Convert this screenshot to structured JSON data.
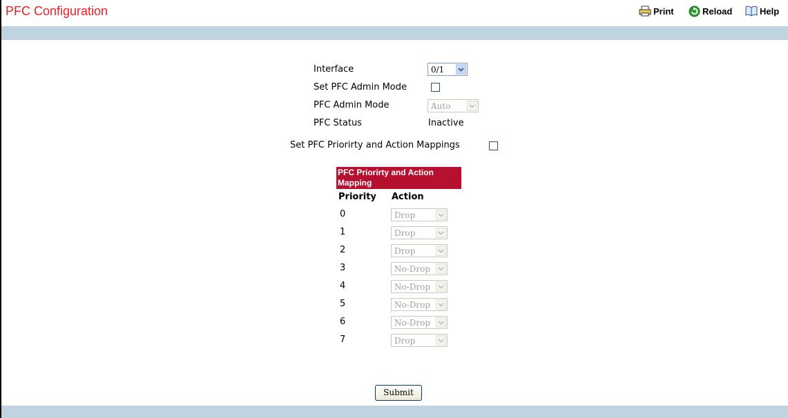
{
  "header": {
    "title": "PFC Configuration",
    "print_label": "Print",
    "reload_label": "Reload",
    "help_label": "Help"
  },
  "form": {
    "interface_label": "Interface",
    "interface_value": "0/1",
    "set_admin_mode_label": "Set PFC Admin Mode",
    "admin_mode_label": "PFC Admin Mode",
    "admin_mode_value": "Auto",
    "status_label": "PFC Status",
    "status_value": "Inactive",
    "set_mappings_label": "Set PFC Priorirty and Action Mappings"
  },
  "mapping": {
    "header": "PFC Priorirty and Action Mapping",
    "priority_col": "Priority",
    "action_col": "Action",
    "rows": [
      {
        "priority": "0",
        "action": "Drop"
      },
      {
        "priority": "1",
        "action": "Drop"
      },
      {
        "priority": "2",
        "action": "Drop"
      },
      {
        "priority": "3",
        "action": "No-Drop"
      },
      {
        "priority": "4",
        "action": "No-Drop"
      },
      {
        "priority": "5",
        "action": "No-Drop"
      },
      {
        "priority": "6",
        "action": "No-Drop"
      },
      {
        "priority": "7",
        "action": "Drop"
      }
    ]
  },
  "submit_label": "Submit",
  "colors": {
    "title": "#ee1d24",
    "band": "#bfd4e0",
    "mapping_header": "#b5102f"
  },
  "icons": {
    "print": "printer-icon",
    "reload": "reload-icon",
    "help": "book-icon"
  }
}
